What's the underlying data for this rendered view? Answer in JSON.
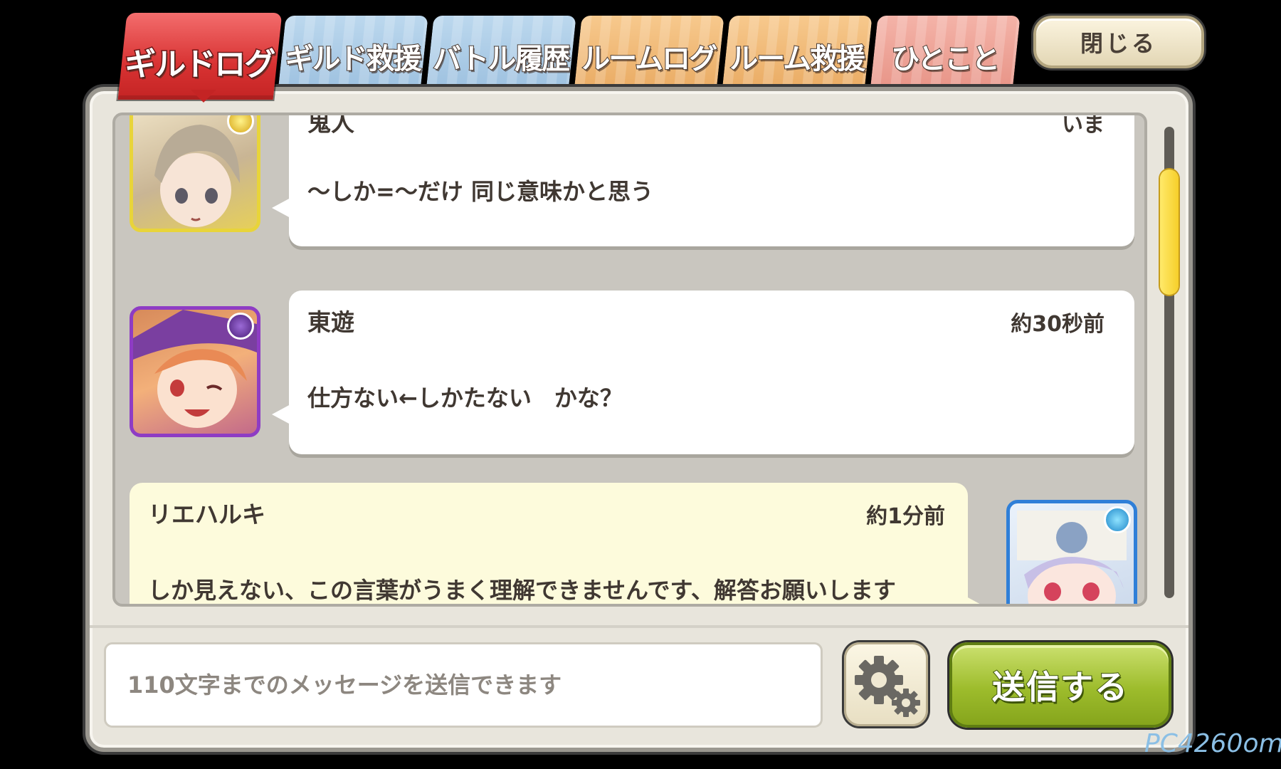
{
  "tabs": [
    {
      "label": "ギルドログ",
      "active": true
    },
    {
      "label": "ギルド救援",
      "active": false
    },
    {
      "label": "バトル履歴",
      "active": false
    },
    {
      "label": "ルームログ",
      "active": false
    },
    {
      "label": "ルーム救援",
      "active": false
    },
    {
      "label": "ひとこと",
      "active": false
    }
  ],
  "close_label": "閉じる",
  "messages": [
    {
      "name": "鬼人",
      "time": "いま",
      "text": "～しか=～だけ 同じ意味かと思う",
      "attribute_icon": "sun-icon",
      "frame_color": "#e8d43a"
    },
    {
      "name": "東遊",
      "time": "約30秒前",
      "text": "仕方ない←しかたない　かな？",
      "attribute_icon": "moon-icon",
      "frame_color": "#8e3cc4"
    },
    {
      "name": "リエハルキ",
      "time": "約1分前",
      "text": "しか見えない、この言葉がうまく理解できませんです、解答お願いします",
      "attribute_icon": "water-icon",
      "frame_color": "#2f7fd8"
    }
  ],
  "input": {
    "placeholder": "110文字までのメッセージを送信できます",
    "value": ""
  },
  "send_label": "送信する",
  "watermark": "PC4260om",
  "colors": {
    "active_tab": "#d83232",
    "guild_tabs": "#9cc0df",
    "room_tabs": "#e9aa62",
    "hitokoto_tab": "#e79386",
    "send_button": "#9dbc2c",
    "scroll_thumb": "#f6cf2a"
  }
}
